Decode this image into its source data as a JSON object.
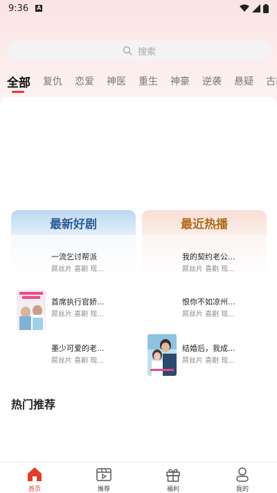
{
  "status_bar": {
    "time": "9:36",
    "notification_icon": "A"
  },
  "search": {
    "placeholder": "搜索"
  },
  "tabs": [
    {
      "label": "全部",
      "active": true
    },
    {
      "label": "复仇"
    },
    {
      "label": "恋爱"
    },
    {
      "label": "神医"
    },
    {
      "label": "重生"
    },
    {
      "label": "神豪"
    },
    {
      "label": "逆袭"
    },
    {
      "label": "悬疑"
    },
    {
      "label": "古装"
    }
  ],
  "cards": {
    "new": {
      "title": "最新好剧",
      "items": [
        {
          "title": "一流乞讨帮派",
          "tags": "屌丝片 喜剧 现..."
        },
        {
          "title": "首席执行官娇...",
          "tags": "屌丝片 喜剧 现...",
          "thumb": "poster-pink"
        },
        {
          "title": "墨少可爱的老...",
          "tags": "屌丝片 喜剧 现..."
        }
      ]
    },
    "hot": {
      "title": "最近热播",
      "items": [
        {
          "title": "我的契约老公...",
          "tags": "屌丝片 喜剧 现..."
        },
        {
          "title": "恨你不如凉州...",
          "tags": "屌丝片 喜剧 现..."
        },
        {
          "title": "结婚后，我成...",
          "tags": "屌丝片 喜剧 现...",
          "thumb": "poster-blue"
        }
      ]
    }
  },
  "section": {
    "popular_title": "热门推荐"
  },
  "bottom_nav": [
    {
      "label": "首页",
      "icon": "home-icon",
      "active": true
    },
    {
      "label": "推荐",
      "icon": "video-icon"
    },
    {
      "label": "福利",
      "icon": "gift-icon"
    },
    {
      "label": "我的",
      "icon": "user-icon"
    }
  ],
  "colors": {
    "accent": "#e23c2c",
    "new_title": "#2e5c9a",
    "hot_title": "#b06a1a"
  }
}
